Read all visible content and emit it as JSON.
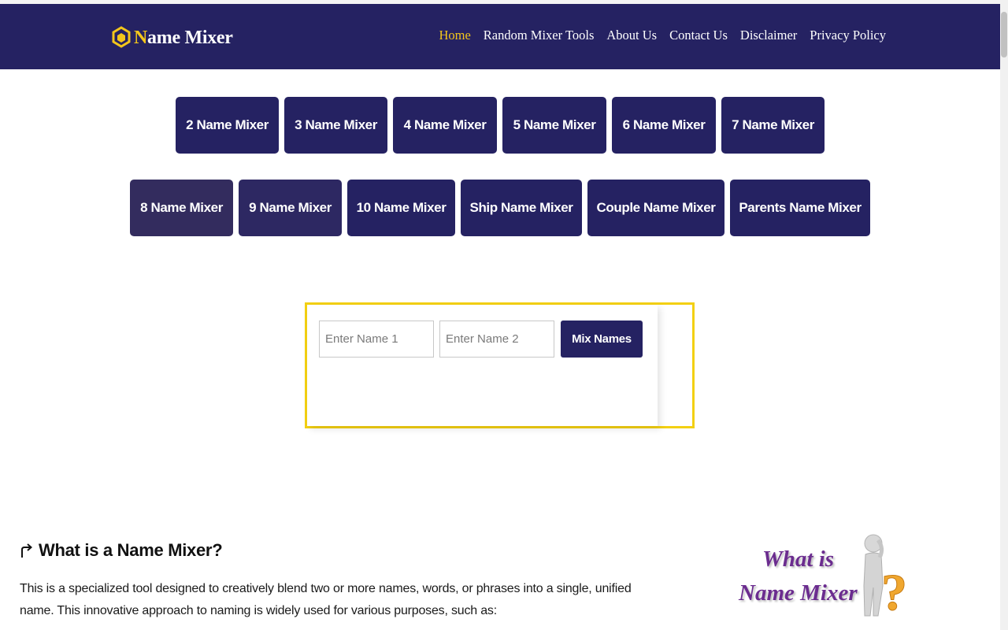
{
  "header": {
    "logo_first": "N",
    "logo_rest": "ame Mixer",
    "nav": [
      {
        "label": "Home",
        "active": true
      },
      {
        "label": "Random Mixer Tools"
      },
      {
        "label": "About Us"
      },
      {
        "label": "Contact Us"
      },
      {
        "label": "Disclaimer"
      },
      {
        "label": "Privacy Policy"
      }
    ]
  },
  "tools_row1": [
    "2 Name Mixer",
    "3 Name Mixer",
    "4 Name Mixer",
    "5 Name Mixer",
    "6 Name Mixer",
    "7 Name Mixer"
  ],
  "tools_row2": [
    "8 Name Mixer",
    "9 Name Mixer",
    "10 Name Mixer",
    "Ship Name Mixer",
    "Couple Name Mixer",
    "Parents Name Mixer"
  ],
  "mixer": {
    "name1_placeholder": "Enter Name 1",
    "name2_placeholder": "Enter Name 2",
    "button_label": "Mix Names"
  },
  "article": {
    "heading": "What is a Name Mixer?",
    "body": "This is a specialized tool designed to creatively blend two or more names, words, or phrases into a single, unified name. This innovative approach to naming is widely used for various purposes, such as:"
  },
  "illustration": {
    "line1": "What is",
    "line2": "Name Mixer",
    "question_mark": "?"
  },
  "colors": {
    "brand_navy": "#252262",
    "accent_yellow": "#f3c61b",
    "box_border": "#f3d012",
    "illustration_purple": "#6b2c8f"
  }
}
